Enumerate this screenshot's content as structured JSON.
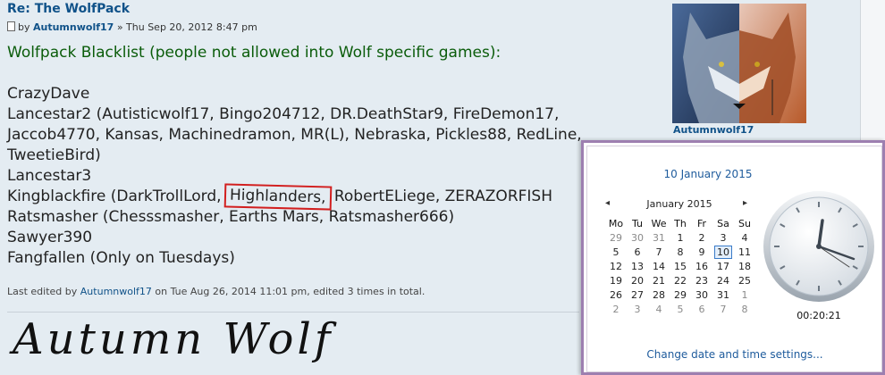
{
  "post": {
    "title": "Re: The WolfPack",
    "byline_prefix": "by",
    "author": "Autumnwolf17",
    "date": "» Thu Sep 20, 2012 8:47 pm",
    "heading": "Wolfpack Blacklist (people not allowed into Wolf specific games):",
    "lines": [
      "CrazyDave",
      "Lancestar2 (Autisticwolf17, Bingo204712, DR.DeathStar9, FireDemon17,",
      "Jaccob4770, Kansas, Machinedramon, MR(L), Nebraska, Pickles88, RedLine,",
      "TweetieBird)",
      "Lancestar3"
    ],
    "kingblackfire_pre": "Kingblackfire (DarkTrollLord, ",
    "highlight": "Highlanders,",
    "kingblackfire_post": " RobertELiege, ZERAZORFISH",
    "lines2": [
      "Ratsmasher (Chesssmasher, Earths Mars, Ratsmasher666)",
      "Sawyer390",
      "Fangfallen (Only on Tuesdays)"
    ],
    "edit_prefix": "Last edited by",
    "edit_author": "Autumnwolf17",
    "edit_suffix": "on Tue Aug 26, 2014 11:01 pm, edited 3 times in total.",
    "signature": "Autumn Wolf"
  },
  "profile": {
    "name": "Autumnwolf17"
  },
  "datetime_popup": {
    "long_date": "10 January 2015",
    "month_label": "January 2015",
    "prev": "◂",
    "next": "▸",
    "weekdays": [
      "Mo",
      "Tu",
      "We",
      "Th",
      "Fr",
      "Sa",
      "Su"
    ],
    "weeks": [
      [
        "29",
        "30",
        "31",
        "1",
        "2",
        "3",
        "4"
      ],
      [
        "5",
        "6",
        "7",
        "8",
        "9",
        "10",
        "11"
      ],
      [
        "12",
        "13",
        "14",
        "15",
        "16",
        "17",
        "18"
      ],
      [
        "19",
        "20",
        "21",
        "22",
        "23",
        "24",
        "25"
      ],
      [
        "26",
        "27",
        "28",
        "29",
        "30",
        "31",
        "1"
      ],
      [
        "2",
        "3",
        "4",
        "5",
        "6",
        "7",
        "8"
      ]
    ],
    "selected_day": "10",
    "time": "00:20:21",
    "change_link": "Change date and time settings..."
  }
}
